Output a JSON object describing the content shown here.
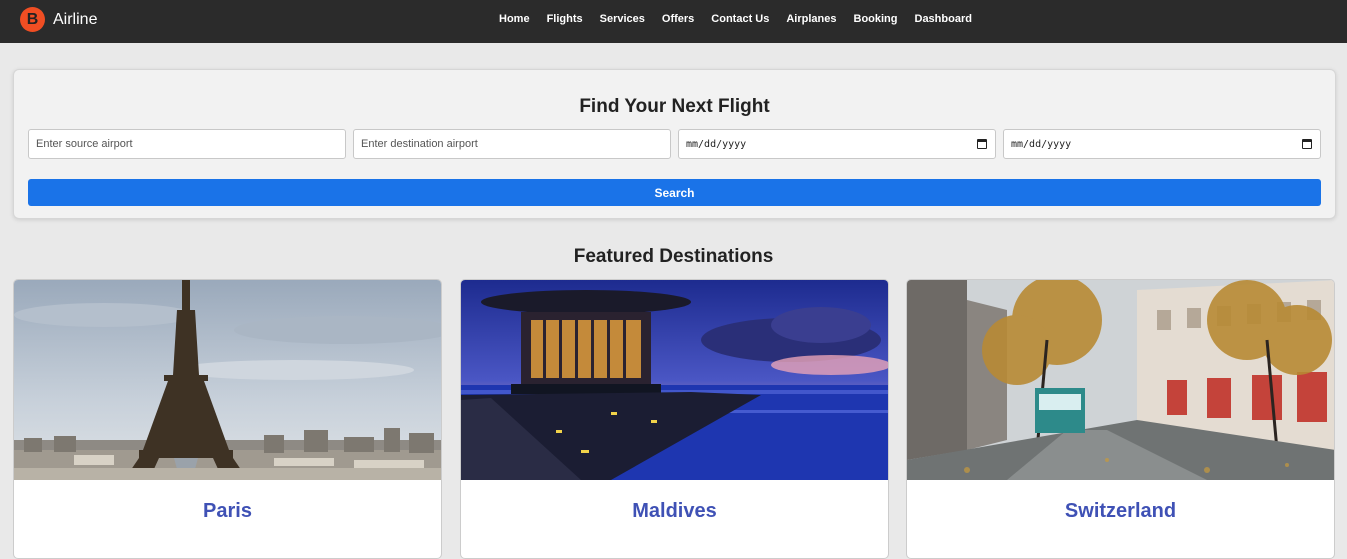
{
  "brand": {
    "logo_letter": "B",
    "name": "Airline"
  },
  "nav": {
    "items": [
      "Home",
      "Flights",
      "Services",
      "Offers",
      "Contact Us",
      "Airplanes",
      "Booking",
      "Dashboard"
    ]
  },
  "search": {
    "title": "Find Your Next Flight",
    "source_placeholder": "Enter source airport",
    "destination_placeholder": "Enter destination airport",
    "depart_date": "mm/dd/yyyy",
    "return_date": "mm/dd/yyyy",
    "button_label": "Search"
  },
  "featured": {
    "title": "Featured Destinations",
    "destinations": [
      {
        "name": "Paris"
      },
      {
        "name": "Maldives"
      },
      {
        "name": "Switzerland"
      }
    ]
  },
  "colors": {
    "navbar": "#2b2b2b",
    "brand_logo": "#f04e23",
    "primary_button": "#1a73e8",
    "destination_name": "#3f51b5"
  }
}
